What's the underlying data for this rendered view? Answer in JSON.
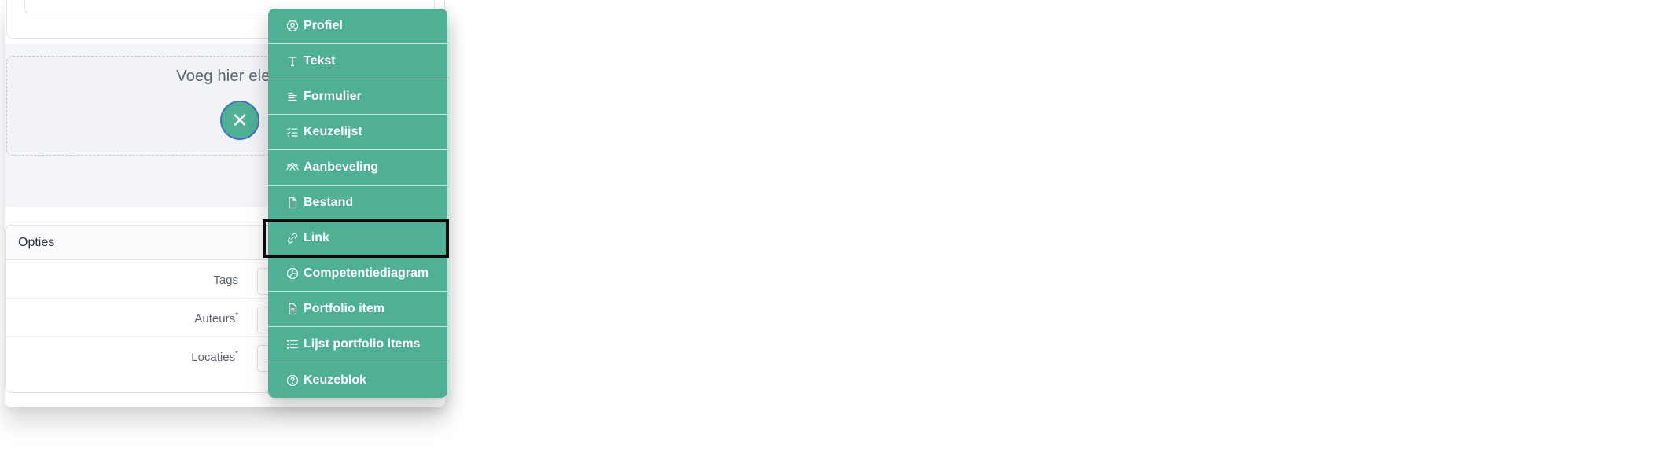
{
  "dropzone": {
    "prompt": "Voeg hier elementen toe",
    "add_button_symbol": "✕"
  },
  "options": {
    "title": "Opties",
    "rows": [
      {
        "label": "Tags",
        "required": ""
      },
      {
        "label": "Auteurs",
        "required": "*"
      },
      {
        "label": "Locaties",
        "required": "*"
      }
    ]
  },
  "menu": {
    "items": [
      {
        "label": "Profiel",
        "icon": "user-circle-icon"
      },
      {
        "label": "Tekst",
        "icon": "text-icon"
      },
      {
        "label": "Formulier",
        "icon": "align-left-icon"
      },
      {
        "label": "Keuzelijst",
        "icon": "checklist-icon"
      },
      {
        "label": "Aanbeveling",
        "icon": "users-icon"
      },
      {
        "label": "Bestand",
        "icon": "file-icon"
      },
      {
        "label": "Link",
        "icon": "link-icon",
        "highlighted": true
      },
      {
        "label": "Competentiediagram",
        "icon": "pie-chart-icon"
      },
      {
        "label": "Portfolio item",
        "icon": "file-text-icon"
      },
      {
        "label": "Lijst portfolio items",
        "icon": "list-icon"
      },
      {
        "label": "Keuzeblok",
        "icon": "question-circle-icon"
      }
    ]
  },
  "colors": {
    "accent": "#4fb095",
    "add_button_border": "#3f6fc8",
    "highlight_outline": "#0c0c0c"
  }
}
